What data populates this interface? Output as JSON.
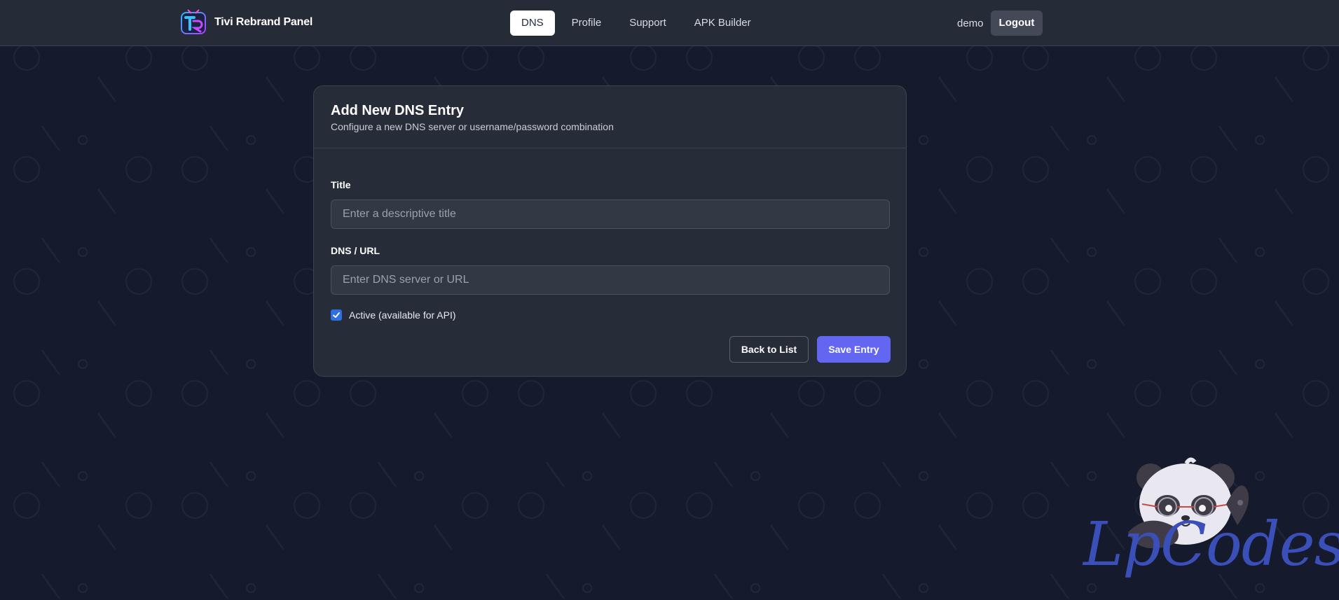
{
  "header": {
    "brand_name": "Tivi Rebrand Panel",
    "logo_icon": "tr-logo-icon",
    "nav": [
      {
        "label": "DNS",
        "active": true
      },
      {
        "label": "Profile",
        "active": false
      },
      {
        "label": "Support",
        "active": false
      },
      {
        "label": "APK Builder",
        "active": false
      }
    ],
    "username": "demo",
    "logout_label": "Logout"
  },
  "form": {
    "title": "Add New DNS Entry",
    "subtitle": "Configure a new DNS server or username/password combination",
    "title_field": {
      "label": "Title",
      "value": "",
      "placeholder": "Enter a descriptive title"
    },
    "dns_field": {
      "label": "DNS / URL",
      "value": "",
      "placeholder": "Enter DNS server or URL"
    },
    "active_checkbox": {
      "label": "Active (available for API)",
      "checked": true
    },
    "back_label": "Back to List",
    "save_label": "Save Entry"
  },
  "watermark": {
    "text": "LpCodes",
    "icon": "panda-mascot-icon"
  },
  "colors": {
    "background": "#151b2c",
    "header": "#252b37",
    "card": "#262c38",
    "primary": "#6366f1",
    "checkbox": "#2f6fe4"
  }
}
